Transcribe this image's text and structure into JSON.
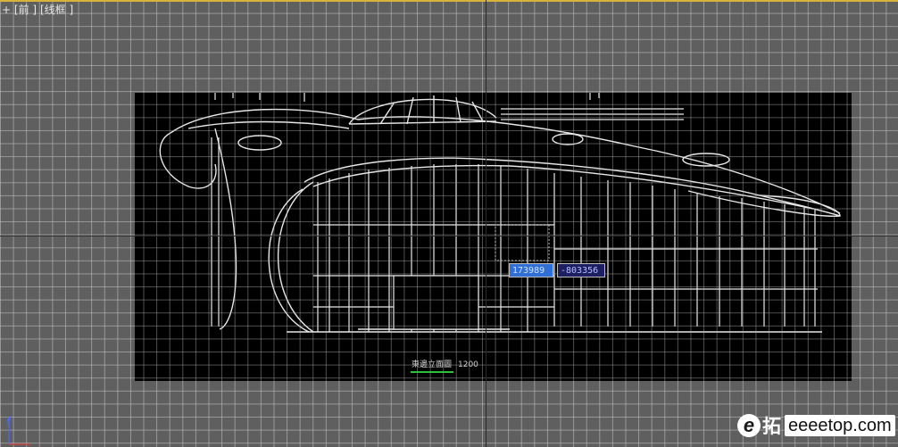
{
  "viewport": {
    "label_parts": [
      "+",
      "[",
      "前",
      "]",
      "[",
      "线框",
      "]"
    ]
  },
  "coordinates": {
    "x_value": "173989",
    "y_value": "-803356"
  },
  "drawing": {
    "caption": "東邊立面圖",
    "scale": "1200"
  },
  "watermark": {
    "logo_letter": "e",
    "logo_char": "拓",
    "domain": "eeeetop.com"
  },
  "colors": {
    "viewport_background": "#5f5f5f",
    "viewport_border": "#d8b23a",
    "reference_image_background": "#000000",
    "x_field": "#2f6fd6",
    "y_field": "#1d1f63",
    "caption_underline": "#2ec03a"
  },
  "icons": {
    "axis_tripod": "axis-tripod-icon"
  }
}
